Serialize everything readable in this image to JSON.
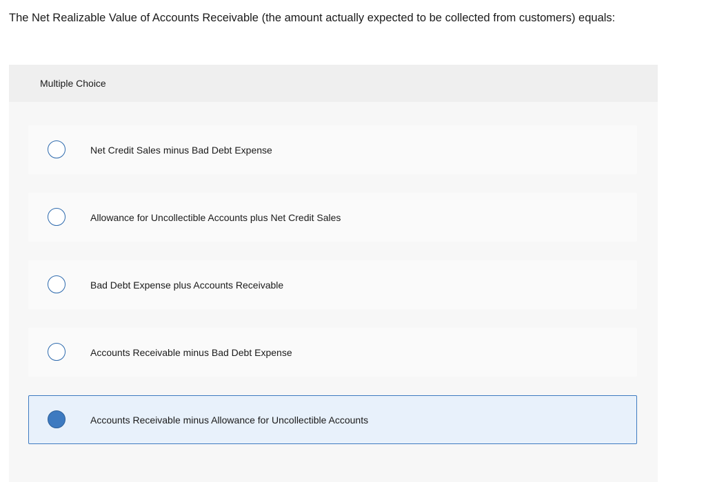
{
  "question": {
    "text": "The Net Realizable Value of Accounts Receivable (the amount actually expected to be collected from customers) equals:"
  },
  "multiple_choice": {
    "header_label": "Multiple Choice",
    "options": [
      {
        "label": "Net Credit Sales minus Bad Debt Expense",
        "selected": false
      },
      {
        "label": "Allowance for Uncollectible Accounts plus Net Credit Sales",
        "selected": false
      },
      {
        "label": "Bad Debt Expense plus Accounts Receivable",
        "selected": false
      },
      {
        "label": "Accounts Receivable minus Bad Debt Expense",
        "selected": false
      },
      {
        "label": "Accounts Receivable minus Allowance for Uncollectible Accounts",
        "selected": true
      }
    ]
  },
  "colors": {
    "accent": "#3d7ac0",
    "selected_background": "#e8f1fb",
    "option_background": "#fafafa",
    "panel_background": "#f7f7f7",
    "header_background": "#efefef"
  }
}
